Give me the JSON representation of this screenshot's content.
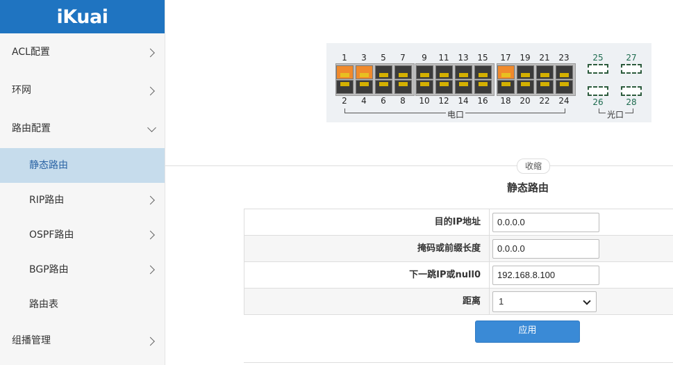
{
  "brand": {
    "logo_text": "iKuai",
    "color": "#1f74c1"
  },
  "sidebar": {
    "items": [
      {
        "label": "ACL配置"
      },
      {
        "label": "环网"
      },
      {
        "label": "路由配置"
      },
      {
        "label": "静态路由"
      },
      {
        "label": "RIP路由"
      },
      {
        "label": "OSPF路由"
      },
      {
        "label": "BGP路由"
      },
      {
        "label": "路由表"
      },
      {
        "label": "组播管理"
      }
    ]
  },
  "ports": {
    "odd": [
      "1",
      "3",
      "5",
      "7",
      "9",
      "11",
      "13",
      "15",
      "17",
      "19",
      "21",
      "23"
    ],
    "even": [
      "2",
      "4",
      "6",
      "8",
      "10",
      "12",
      "14",
      "16",
      "18",
      "20",
      "22",
      "24"
    ],
    "optical_top": [
      "25",
      "27"
    ],
    "optical_bottom": [
      "26",
      "28"
    ],
    "electric_label": "电口",
    "optical_label": "光口",
    "active_ports": [
      "1",
      "3",
      "17"
    ],
    "active_color": "#f08a2c"
  },
  "collapse_label": "收缩",
  "form": {
    "title": "静态路由",
    "dest_ip_label": "目的IP地址",
    "dest_ip_value": "0.0.0.0",
    "mask_label": "掩码或前缀长度",
    "mask_value": "0.0.0.0",
    "next_hop_label": "下一跳IP或null0",
    "next_hop_value": "192.168.8.100",
    "distance_label": "距离",
    "distance_value": "1",
    "apply_label": "应用"
  }
}
